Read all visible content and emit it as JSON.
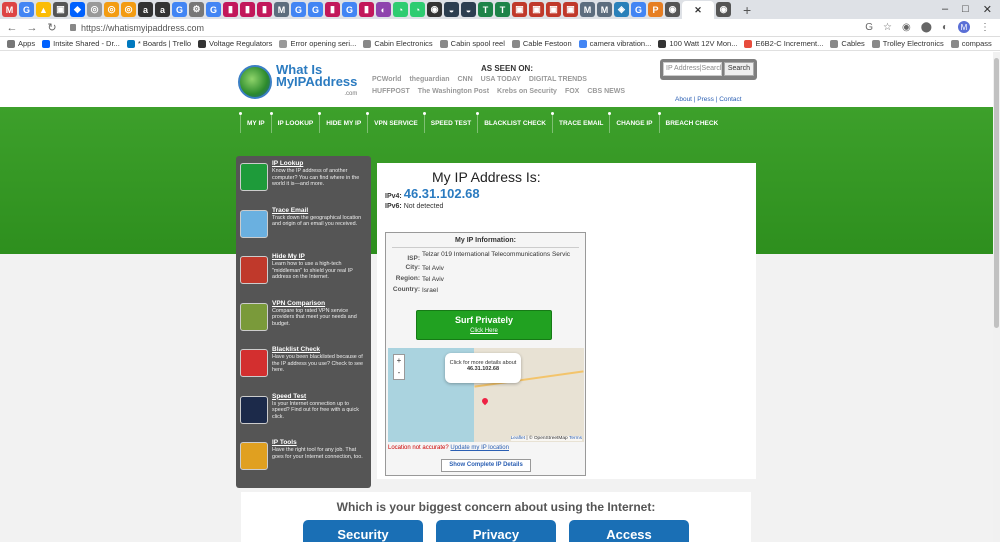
{
  "browser": {
    "url": "https://whatismyipaddress.com",
    "bookmarks": [
      "Apps",
      "Intsite Shared - Dr...",
      "* Boards | Trello",
      "Voltage Regulators",
      "Error opening seri...",
      "Cabin Electronics",
      "Cabin spool reel",
      "Cable Festoon",
      "camera vibration...",
      "100 Watt 12V Mon...",
      "E6B2-C Increment...",
      "Cables",
      "Trolley Electronics",
      "compass"
    ],
    "avatar_letter": "M"
  },
  "header": {
    "logo_line1": "What Is",
    "logo_line2": "MyIPAddress",
    "logo_line3": ".com",
    "as_seen_on": "AS SEEN ON:",
    "media_row1": [
      "PCWorld",
      "theguardian",
      "CNN",
      "USA TODAY",
      "DIGITAL TRENDS"
    ],
    "media_row2": [
      "HUFFPOST",
      "The Washington Post",
      "Krebs on Security",
      "FOX",
      "CBS NEWS"
    ],
    "search_placeholder": "IP Address|Search",
    "search_button": "Search",
    "toplinks": "About | Press | Contact"
  },
  "nav": [
    "MY IP",
    "IP LOOKUP",
    "HIDE MY IP",
    "VPN SERVICE",
    "SPEED TEST",
    "BLACKLIST CHECK",
    "TRACE EMAIL",
    "CHANGE IP",
    "BREACH CHECK"
  ],
  "sidebar": [
    {
      "title": "IP Lookup",
      "text": "Know the IP address of another computer? You can find where in the world it is—and more.",
      "color": "#1e9b3a"
    },
    {
      "title": "Trace Email",
      "text": "Track down the geographical location and origin of an email you received.",
      "color": "#6ab0e0"
    },
    {
      "title": "Hide My IP",
      "text": "Learn how to use a high-tech \"middleman\" to shield your real IP address on the Internet.",
      "color": "#c0392b"
    },
    {
      "title": "VPN Comparison",
      "text": "Compare top rated VPN service providers that meet your needs and budget.",
      "color": "#7a9a3a"
    },
    {
      "title": "Blacklist Check",
      "text": "Have you been blacklisted because of the IP address you use? Check to see here.",
      "color": "#d32f2f"
    },
    {
      "title": "Speed Test",
      "text": "Is your Internet connection up to speed? Find out for free with a quick click.",
      "color": "#1c2a4a"
    },
    {
      "title": "IP Tools",
      "text": "Have the right tool for any job. That goes for your Internet connection, too.",
      "color": "#e0a020"
    }
  ],
  "main": {
    "heading": "My IP Address Is:",
    "ipv4_label": "IPv4:",
    "ipv4": "46.31.102.68",
    "ipv6_label": "IPv6:",
    "ipv6": "Not detected",
    "info_title": "My IP Information:",
    "info": [
      {
        "k": "ISP:",
        "v": "Telzar 019 International Telecommunications Servic"
      },
      {
        "k": "City:",
        "v": "Tel Aviv"
      },
      {
        "k": "Region:",
        "v": "Tel Aviv"
      },
      {
        "k": "Country:",
        "v": "Israel"
      }
    ],
    "surf_title": "Surf Privately",
    "surf_link": "Click Here",
    "map_popup_line1": "Click for more details about",
    "map_popup_ip": "46.31.102.68",
    "map_attr_leaflet": "Leaflet",
    "map_attr_rest": " | © OpenStreetMap ",
    "map_attr_terms": "Terms",
    "not_accurate": "Location not accurate?",
    "update_link": "Update my IP location",
    "show_details": "Show Complete IP Details"
  },
  "concern": {
    "heading": "Which is your biggest concern about using the Internet:",
    "buttons": [
      "Security",
      "Privacy",
      "Access"
    ]
  }
}
